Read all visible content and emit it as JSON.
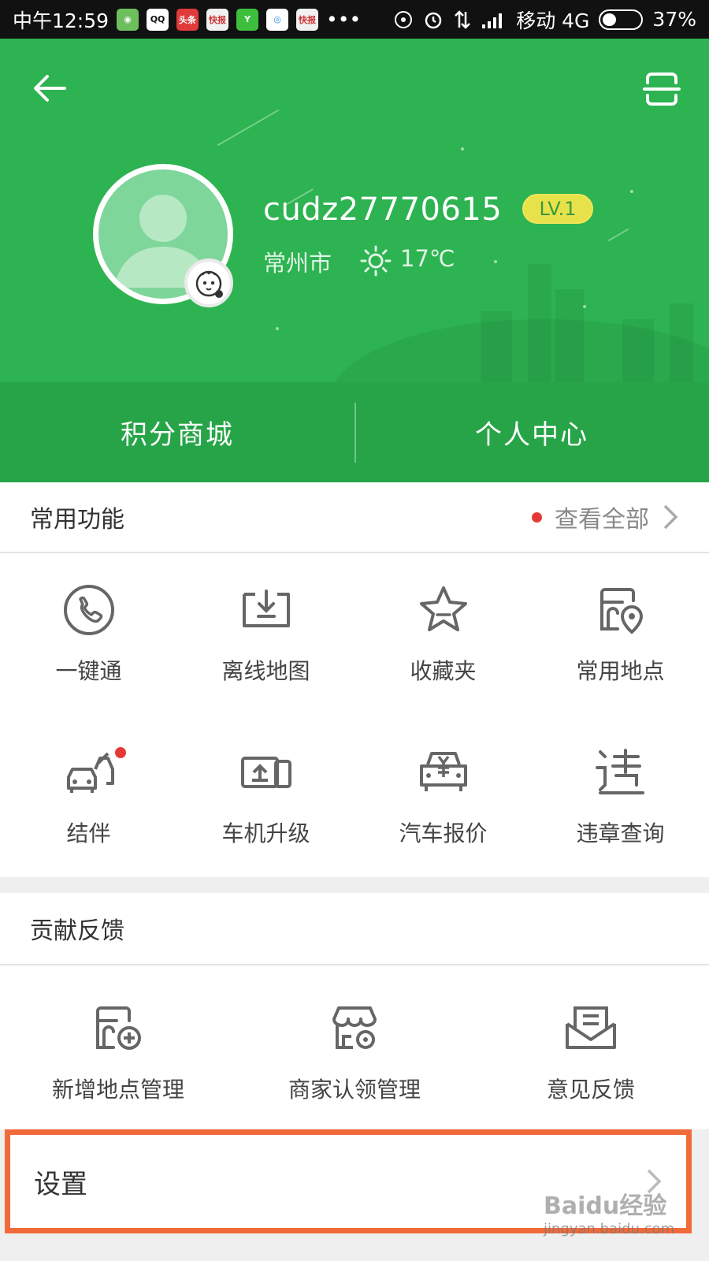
{
  "status_bar": {
    "time": "中午12:59",
    "apps": [
      {
        "label": "◉",
        "color": "#6cbf5c"
      },
      {
        "label": "QQ",
        "color": "#1d1d1d"
      },
      {
        "label": "头条",
        "color": "#e03a3a"
      },
      {
        "label": "快报",
        "color": "#f1f1f1"
      },
      {
        "label": "Y",
        "color": "#3dbf3d"
      },
      {
        "label": "◎",
        "color": "#2f8fe0"
      },
      {
        "label": "快报",
        "color": "#f1f1f1"
      }
    ],
    "more": "•••",
    "carrier": "移动 4G",
    "battery_text": "37%",
    "battery_level": 0.37
  },
  "header": {
    "username": "cudz27770615",
    "level": "LV.1",
    "city": "常州市",
    "temperature": "17℃",
    "tabs": [
      "积分商城",
      "个人中心"
    ]
  },
  "common_functions": {
    "title": "常用功能",
    "view_all": "查看全部",
    "items": [
      {
        "label": "一键通",
        "icon": "phone-icon"
      },
      {
        "label": "离线地图",
        "icon": "offline-map-icon"
      },
      {
        "label": "收藏夹",
        "icon": "star-icon"
      },
      {
        "label": "常用地点",
        "icon": "frequent-place-icon"
      },
      {
        "label": "结伴",
        "icon": "carpool-icon",
        "badge": true
      },
      {
        "label": "车机升级",
        "icon": "car-unit-upgrade-icon"
      },
      {
        "label": "汽车报价",
        "icon": "car-price-icon"
      },
      {
        "label": "违章查询",
        "icon": "violation-icon"
      }
    ]
  },
  "feedback": {
    "title": "贡献反馈",
    "items": [
      {
        "label": "新增地点管理",
        "icon": "add-place-icon"
      },
      {
        "label": "商家认领管理",
        "icon": "merchant-claim-icon"
      },
      {
        "label": "意见反馈",
        "icon": "feedback-mail-icon"
      }
    ]
  },
  "settings": {
    "label": "设置"
  },
  "watermark": {
    "brand": "Baidu经验",
    "url": "jingyan.baidu.com"
  },
  "colors": {
    "brand_green": "#2db351",
    "dark_green": "#27a448",
    "highlight": "#f16a3a",
    "alert_red": "#e53935"
  }
}
